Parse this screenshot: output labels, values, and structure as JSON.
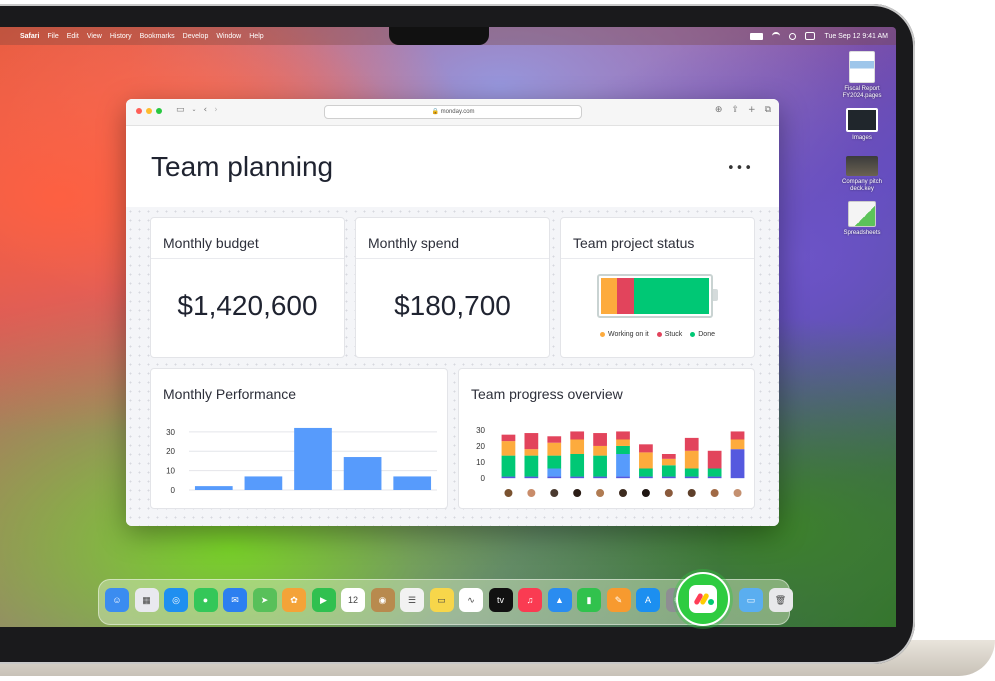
{
  "menubar": {
    "app": "Safari",
    "items": [
      "File",
      "Edit",
      "View",
      "History",
      "Bookmarks",
      "Develop",
      "Window",
      "Help"
    ],
    "datetime": "Tue Sep 12  9:41 AM"
  },
  "desktop": {
    "icons": [
      {
        "label": "Fiscal Report\nFY2024.pages",
        "icon": "pages-document-icon"
      },
      {
        "label": "Images",
        "icon": "folder-icon"
      },
      {
        "label": "Company pitch\ndeck.key",
        "icon": "keynote-document-icon"
      },
      {
        "label": "Spreadsheets",
        "icon": "folder-icon"
      }
    ]
  },
  "browser": {
    "url": "monday.com"
  },
  "page": {
    "title": "Team planning",
    "more_label": "•••"
  },
  "cards": {
    "budget": {
      "title": "Monthly budget",
      "value": "$1,420,600"
    },
    "spend": {
      "title": "Monthly spend",
      "value": "$180,700"
    },
    "status": {
      "title": "Team project status",
      "legend": [
        {
          "label": "Working on it",
          "color": "#fdab3d"
        },
        {
          "label": "Stuck",
          "color": "#e2445c"
        },
        {
          "label": "Done",
          "color": "#00c875"
        }
      ]
    },
    "performance": {
      "title": "Monthly Performance"
    },
    "progress": {
      "title": "Team progress overview"
    }
  },
  "chart_data": [
    {
      "type": "pie",
      "categories": [
        "Working on it",
        "Stuck",
        "Done"
      ],
      "values": [
        15,
        16,
        69
      ],
      "colors": [
        "#fdab3d",
        "#e2445c",
        "#00c875"
      ]
    },
    {
      "type": "bar",
      "yticks": [
        30,
        20,
        10,
        0
      ],
      "ylim": [
        0,
        33
      ],
      "values": [
        2,
        7,
        32,
        17,
        7
      ],
      "color": "#579bfc",
      "grid": true
    },
    {
      "type": "bar",
      "stacked": true,
      "yticks": [
        30,
        20,
        10,
        0
      ],
      "ylim": [
        -3,
        33
      ],
      "series": [
        {
          "color": "#5559df",
          "values": [
            1,
            1,
            1,
            1,
            1,
            1,
            1,
            1,
            1,
            1,
            18
          ]
        },
        {
          "color": "#579bfc",
          "values": [
            0,
            0,
            5,
            0,
            0,
            14,
            0,
            0,
            0,
            0,
            0
          ]
        },
        {
          "color": "#00c875",
          "values": [
            13,
            13,
            8,
            14,
            13,
            5,
            5,
            7,
            5,
            5,
            0
          ]
        },
        {
          "color": "#fdab3d",
          "values": [
            9,
            4,
            8,
            9,
            6,
            4,
            10,
            4,
            11,
            0,
            6
          ]
        },
        {
          "color": "#e2445c",
          "values": [
            4,
            10,
            4,
            5,
            8,
            5,
            5,
            3,
            8,
            11,
            5
          ]
        }
      ],
      "avatars": [
        "avatar-1",
        "avatar-2",
        "avatar-3",
        "avatar-4",
        "avatar-5",
        "avatar-6",
        "avatar-7",
        "avatar-8",
        "avatar-9",
        "avatar-10",
        "avatar-11"
      ]
    }
  ],
  "dock": {
    "apps": [
      {
        "name": "Finder",
        "icon": "finder-icon",
        "color": "#3b8cf0",
        "glyph": "☺"
      },
      {
        "name": "Launchpad",
        "icon": "launchpad-icon",
        "color": "#e9e9ef",
        "glyph": "▦"
      },
      {
        "name": "Safari",
        "icon": "safari-icon",
        "color": "#1f8ff0",
        "glyph": "◎"
      },
      {
        "name": "Messages",
        "icon": "messages-icon",
        "color": "#34c759",
        "glyph": "●"
      },
      {
        "name": "Mail",
        "icon": "mail-icon",
        "color": "#2c7ff0",
        "glyph": "✉"
      },
      {
        "name": "Maps",
        "icon": "maps-icon",
        "color": "#58c05a",
        "glyph": "➤"
      },
      {
        "name": "Photos",
        "icon": "photos-icon",
        "color": "#f4a338",
        "glyph": "✿"
      },
      {
        "name": "FaceTime",
        "icon": "facetime-icon",
        "color": "#30c04f",
        "glyph": "▶"
      },
      {
        "name": "Calendar",
        "icon": "calendar-icon",
        "color": "#ffffff",
        "glyph": "12"
      },
      {
        "name": "Contacts",
        "icon": "contacts-icon",
        "color": "#b88a4e",
        "glyph": "◉"
      },
      {
        "name": "Reminders",
        "icon": "reminders-icon",
        "color": "#f2f2f2",
        "glyph": "☰"
      },
      {
        "name": "Notes",
        "icon": "notes-icon",
        "color": "#f7d64a",
        "glyph": "▭"
      },
      {
        "name": "Freeform",
        "icon": "freeform-icon",
        "color": "#ffffff",
        "glyph": "∿"
      },
      {
        "name": "TV",
        "icon": "tv-icon",
        "color": "#111111",
        "glyph": "tv"
      },
      {
        "name": "Music",
        "icon": "music-icon",
        "color": "#fa3b52",
        "glyph": "♫"
      },
      {
        "name": "Keynote",
        "icon": "keynote-icon",
        "color": "#2a8cf0",
        "glyph": "▲"
      },
      {
        "name": "Numbers",
        "icon": "numbers-icon",
        "color": "#31c24d",
        "glyph": "▮"
      },
      {
        "name": "Pages",
        "icon": "pages-icon",
        "color": "#f79a2f",
        "glyph": "✎"
      },
      {
        "name": "App Store",
        "icon": "app-store-icon",
        "color": "#1c8ff0",
        "glyph": "A"
      },
      {
        "name": "System Settings",
        "icon": "settings-icon",
        "color": "#8e8e93",
        "glyph": "⚙"
      },
      {
        "name": "Folder",
        "icon": "folder-icon",
        "color": "#5aaef0",
        "glyph": "▭"
      },
      {
        "name": "Trash",
        "icon": "trash-icon",
        "color": "#e8e8ea",
        "glyph": "🗑"
      }
    ],
    "highlighted_app": "monday.com"
  }
}
